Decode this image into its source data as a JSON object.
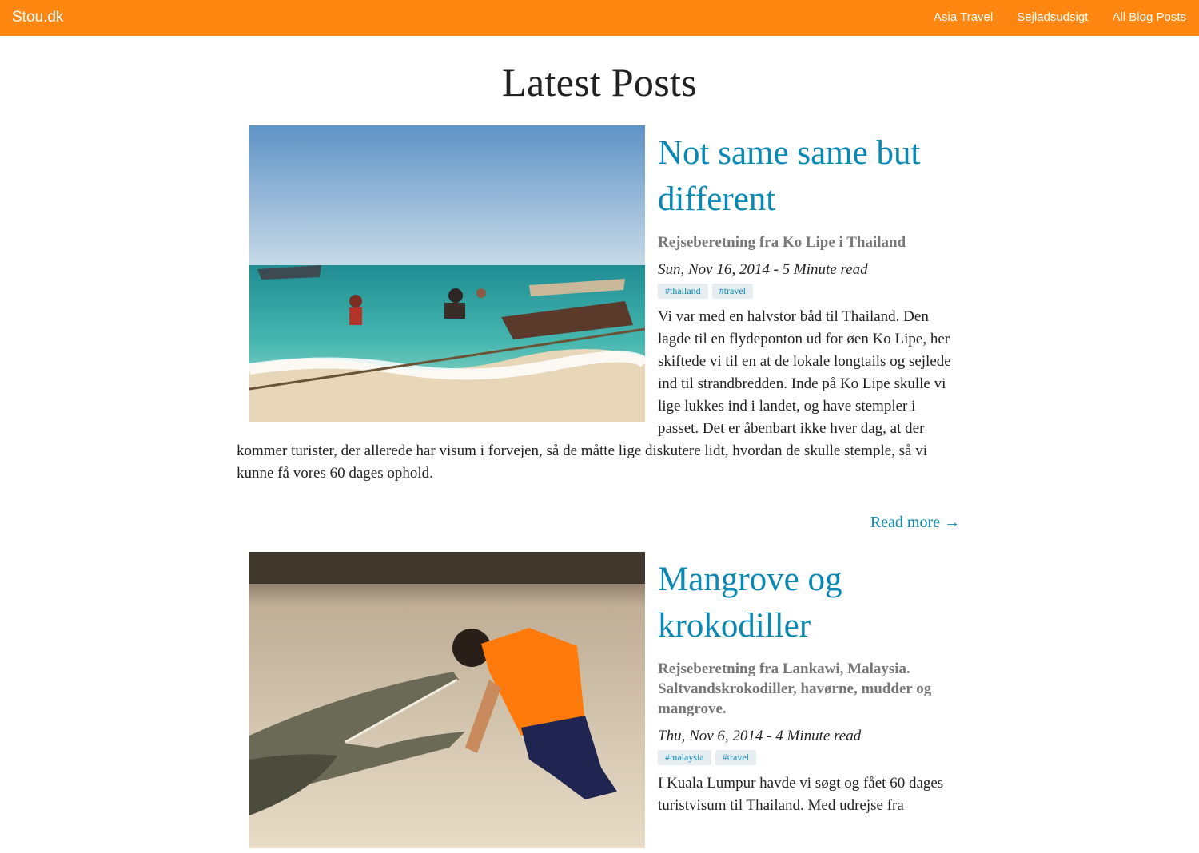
{
  "navbar": {
    "brand": "Stou.dk",
    "links": [
      "Asia Travel",
      "Sejladsudsigt",
      "All Blog Posts"
    ],
    "background_color": "#ff8711"
  },
  "page": {
    "title": "Latest Posts"
  },
  "posts": [
    {
      "title": "Not same same but different",
      "subtitle": "Rejseberetning fra Ko Lipe i Thailand",
      "meta": "Sun, Nov 16, 2014 - 5 Minute read",
      "tags": [
        "#thailand",
        "#travel"
      ],
      "excerpt": "Vi var med en halvstor båd til Thailand. Den lagde til en flydeponton ud for øen Ko Lipe, her skiftede vi til en at de lokale longtails og sejlede ind til strandbredden. Inde på Ko Lipe skulle vi lige lukkes ind i landet, og have stempler i passet. Det er åbenbart ikke hver dag, at der kommer turister, der allerede har visum i forvejen, så de måtte lige diskutere lidt, hvordan de skulle stemple, så vi kunne få vores 60 dages ophold.",
      "read_more": "Read more →"
    },
    {
      "title": "Mangrove og krokodiller",
      "subtitle": "Rejseberetning fra Lankawi, Malaysia. Saltvandskrokodiller, havørne, mudder og mangrove.",
      "meta": "Thu, Nov 6, 2014 - 4 Minute read",
      "tags": [
        "#malaysia",
        "#travel"
      ],
      "excerpt": "I Kuala Lumpur havde vi søgt og fået 60 dages turistvisum til Thailand. Med udrejse fra"
    }
  ],
  "colors": {
    "link": "#0a88b4",
    "subtitle": "#777777",
    "tag_bg": "#e6edf1"
  }
}
